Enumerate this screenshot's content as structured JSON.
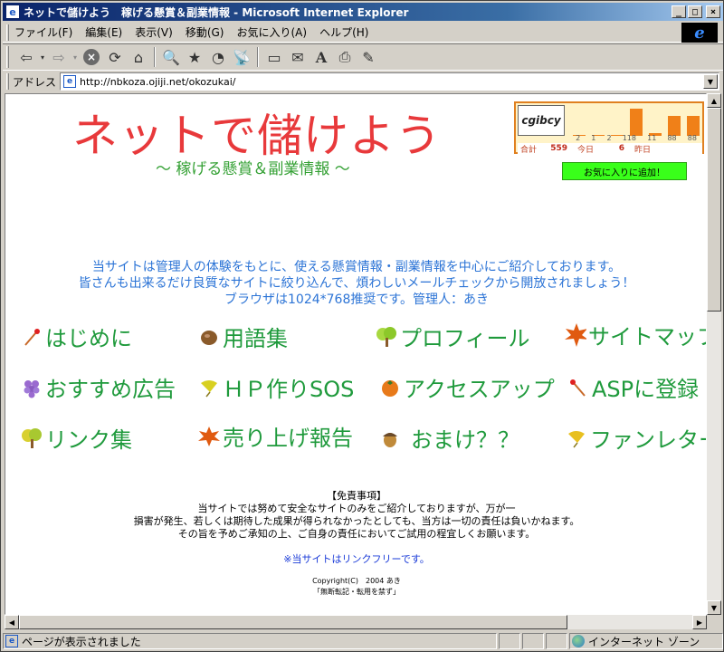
{
  "window": {
    "title": "ネットで儲けよう　稼げる懸賞＆副業情報 - Microsoft Internet Explorer",
    "minimize": "_",
    "maximize": "□",
    "close": "×"
  },
  "menubar": [
    "ファイル(F)",
    "編集(E)",
    "表示(V)",
    "移動(G)",
    "お気に入り(A)",
    "ヘルプ(H)"
  ],
  "toolbar": [
    "back-icon",
    "forward-icon",
    "stop-icon",
    "refresh-icon",
    "home-icon",
    "search-icon",
    "favorites-icon",
    "history-icon",
    "channels-icon",
    "fullscreen-icon",
    "mail-icon",
    "font-icon",
    "print-icon",
    "edit-icon"
  ],
  "address": {
    "label": "アドレス",
    "url": "http://nbkoza.ojiji.net/okozukai/"
  },
  "page": {
    "title": "ネットで儲けよう",
    "subtitle": "～ 稼げる懸賞＆副業情報 ～",
    "favorite_button": "お気に入りに追加！",
    "counter": {
      "logo": "cgibcy",
      "day_numbers": [
        "2",
        "1",
        "2",
        "118",
        "11",
        "88",
        "88"
      ],
      "bar_values": [
        2,
        1,
        2,
        118,
        11,
        88,
        88
      ],
      "total_label": "合計",
      "total_value": "559",
      "today_label": "今日",
      "today_value": "6",
      "yesterday_label": "昨日"
    },
    "intro": [
      "当サイトは管理人の体験をもとに、使える懸賞情報・副業情報を中心にご紹介しております。",
      "皆さんも出来るだけ良質なサイトに絞り込んで、煩わしいメールチェックから開放されましょう！",
      "ブラウザは1024*768推奨です。管理人：あき"
    ],
    "nav": [
      {
        "label": "はじめに",
        "icon": "matchstick-icon"
      },
      {
        "label": "用語集",
        "icon": "nut-icon"
      },
      {
        "label": "プロフィール",
        "icon": "tree-icon"
      },
      {
        "label": "サイトマップ",
        "icon": "maple-leaf-icon"
      },
      {
        "label": "おすすめ広告",
        "icon": "grapes-icon"
      },
      {
        "label": "ＨＰ作りSOS",
        "icon": "ginkgo-leaf-icon"
      },
      {
        "label": "アクセスアップ",
        "icon": "persimmon-icon"
      },
      {
        "label": "ASPに登録",
        "icon": "matchstick-icon"
      },
      {
        "label": "リンク集",
        "icon": "tree-icon"
      },
      {
        "label": "売り上げ報告",
        "icon": "maple-leaf-icon"
      },
      {
        "label": "おまけ？？",
        "icon": "acorn-icon"
      },
      {
        "label": "ファンレター",
        "icon": "ginkgo-leaf-icon"
      }
    ],
    "disclaimer": [
      "【免責事項】",
      "当サイトでは努めて安全なサイトのみをご紹介しておりますが、万が一",
      "損害が発生、若しくは期待した成果が得られなかったとしても、当方は一切の責任は負いかねます。",
      "その旨を予めご承知の上、ご自身の責任においてご試用の程宜しくお願います。"
    ],
    "link_free": "※当サイトはリンクフリーです。",
    "copyright": "Copyright(C)　2004 あき",
    "no_copy": "「無断転記・転用を禁ず」"
  },
  "status": {
    "text": "ページが表示されました",
    "zone": "インターネット ゾーン"
  },
  "colors": {
    "title_red": "#e8393b",
    "nav_green": "#1f9a3c",
    "intro_blue": "#2c74d6",
    "fav_green": "#39ff1a",
    "counter_orange": "#f08018"
  }
}
